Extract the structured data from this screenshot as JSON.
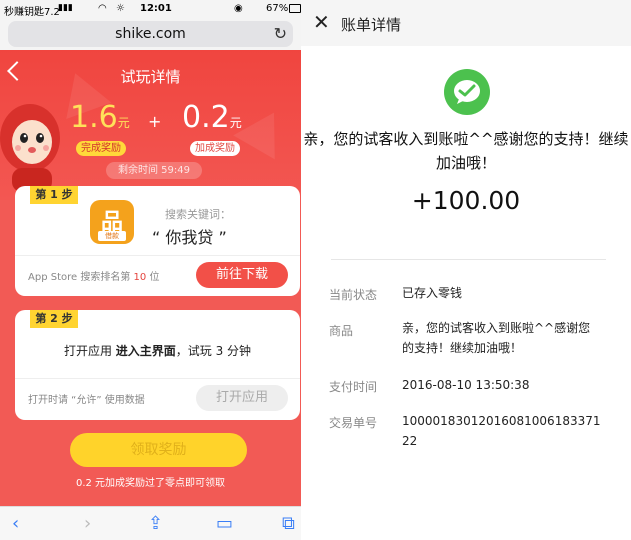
{
  "status_bar": {
    "carrier": "秒赚钥匙7.2",
    "time": "12:01",
    "battery": "67%"
  },
  "browser": {
    "url": "shike.com"
  },
  "trial": {
    "title": "试玩详情",
    "reward_main_value": "1.6",
    "reward_main_unit": "元",
    "plus": "+",
    "reward_bonus_value": "0.2",
    "reward_bonus_unit": "元",
    "reward_main_tag": "完成奖励",
    "reward_bonus_tag": "加成奖励",
    "countdown": "剩余时间 59:49",
    "step1": {
      "badge": "第 1 步",
      "app_icon_text": "品",
      "app_icon_sub": "借款",
      "keyword_label": "搜索关键词：",
      "keyword_value": "“ 你我贷 ”",
      "rank_prefix": "App Store 搜索排名第",
      "rank_num": "10",
      "rank_suffix": "位",
      "download_button": "前往下载"
    },
    "step2": {
      "badge": "第 2 步",
      "instr_pre": "打开应用",
      "instr_bold": "进入主界面",
      "instr_post": "，试玩 3 分钟",
      "allow_note": "打开时请 “允许” 使用数据",
      "open_button": "打开应用"
    },
    "claim_button": "领取奖励",
    "bonus_note": "0.2 元加成奖励过了零点即可领取"
  },
  "bill": {
    "title": "账单详情",
    "message": "亲，您的试客收入到账啦^^感谢您的支持！继续加油哦！",
    "amount": "+100.00",
    "rows": [
      {
        "label": "当前状态",
        "value": "已存入零钱"
      },
      {
        "label": "商品",
        "value": "亲，您的试客收入到账啦^^感谢您的支持！继续加油哦！"
      },
      {
        "label": "支付时间",
        "value": "2016-08-10 13:50:38"
      },
      {
        "label": "交易单号",
        "value": "10000183012016081006183371 22"
      }
    ]
  },
  "colors": {
    "brand_red": "#f25a55",
    "accent_yellow": "#ffd32a",
    "wechat_green": "#4cc14e"
  }
}
